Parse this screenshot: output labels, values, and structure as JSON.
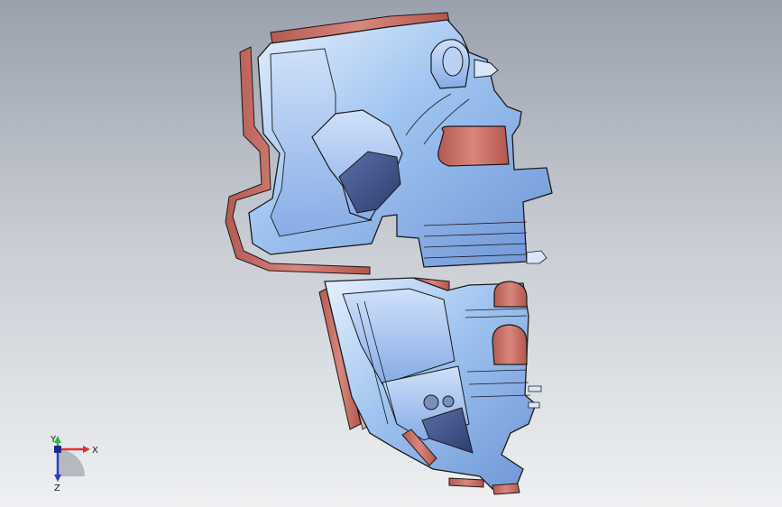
{
  "viewport": {
    "colors": {
      "surface": "#8fb6ea",
      "surface_light": "#dbe9fb",
      "flange": "#c9695e",
      "edge": "#1a1a1a",
      "axis_x": "#e53226",
      "axis_y": "#2bb64b",
      "axis_z": "#2c3fc4"
    }
  },
  "triad": {
    "x_label": "X",
    "y_label": "Y",
    "z_label": "Z"
  }
}
